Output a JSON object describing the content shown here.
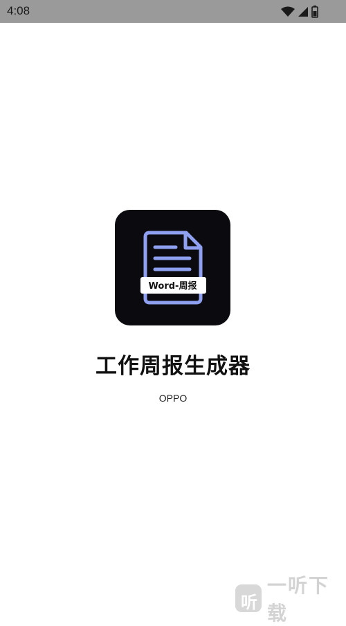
{
  "status_bar": {
    "time": "4:08",
    "icons": [
      "wifi-icon",
      "cellular-signal-icon",
      "battery-icon"
    ]
  },
  "app": {
    "icon_badge": "Word-周报",
    "title": "工作周报生成器",
    "vendor": "OPPO"
  },
  "watermark": {
    "logo_glyph": "听",
    "text": "一听下载"
  },
  "colors": {
    "status_bar_bg": "#9a9a9a",
    "icon_bg": "#0b0b0f",
    "document_stroke": "#8fa0f0",
    "background": "#ffffff"
  }
}
